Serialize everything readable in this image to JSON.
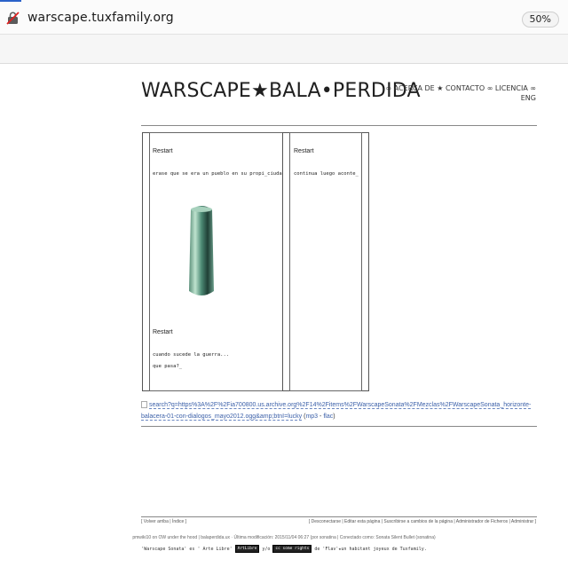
{
  "browser": {
    "url": "warscape.tuxfamily.org",
    "zoom": "50%"
  },
  "site": {
    "title": "WARSCAPE★BALA•PERDIDA",
    "nav": {
      "about": "∞ ACERCA DE",
      "sep": "★",
      "contact": "CONTACTO",
      "license": "∞ LICENCIA ∞",
      "lang": "ENG"
    }
  },
  "content": {
    "panel_left": {
      "restart1": "Restart",
      "text1": "erase que se era un pueblo en su propi_ciudad",
      "restart2": "Restart",
      "text2a": "cuando sucede la guerra...",
      "text2b": "que pasa?_"
    },
    "panel_right": {
      "restart": "Restart",
      "text": "continua luego aconte_"
    },
    "search_link": "search?q=https%3A%2F%2Fia700800.us.archive.org%2F14%2Fitems%2FWarscapeSonata%2FMezclas%2FWarscapeSonata_horizonte-balacera-01-con-dialogos_mayo2012.ogg&amp;btnI=lucky",
    "formats_open": "(",
    "format_mp3": "mp3",
    "format_sep": " - ",
    "format_flac": "flac",
    "formats_close": ")"
  },
  "footer": {
    "left": "[ Volver arriba | Índice ]",
    "right": "[ Desconectarse | Editar esta página | Suscribirse a cambios de la página | Administrador de Ficheros | Administrar ]",
    "info": "pmwiki10 on OW under the hood  |  balaperdida.ux · Última modificación: 2015/11/04 06:27 (por sonatina  |  Conectado como: Sonata Silent Bullet (sonatina)",
    "license_pre": "'Warscape Sonata' es ' Arte Libre'",
    "badge_artlibre": "ArtLibre",
    "license_and": "y/o",
    "badge_cc": "cc  some rights",
    "license_post": "de 'Flav'★un habitant joyeux de Tuxfamily."
  }
}
